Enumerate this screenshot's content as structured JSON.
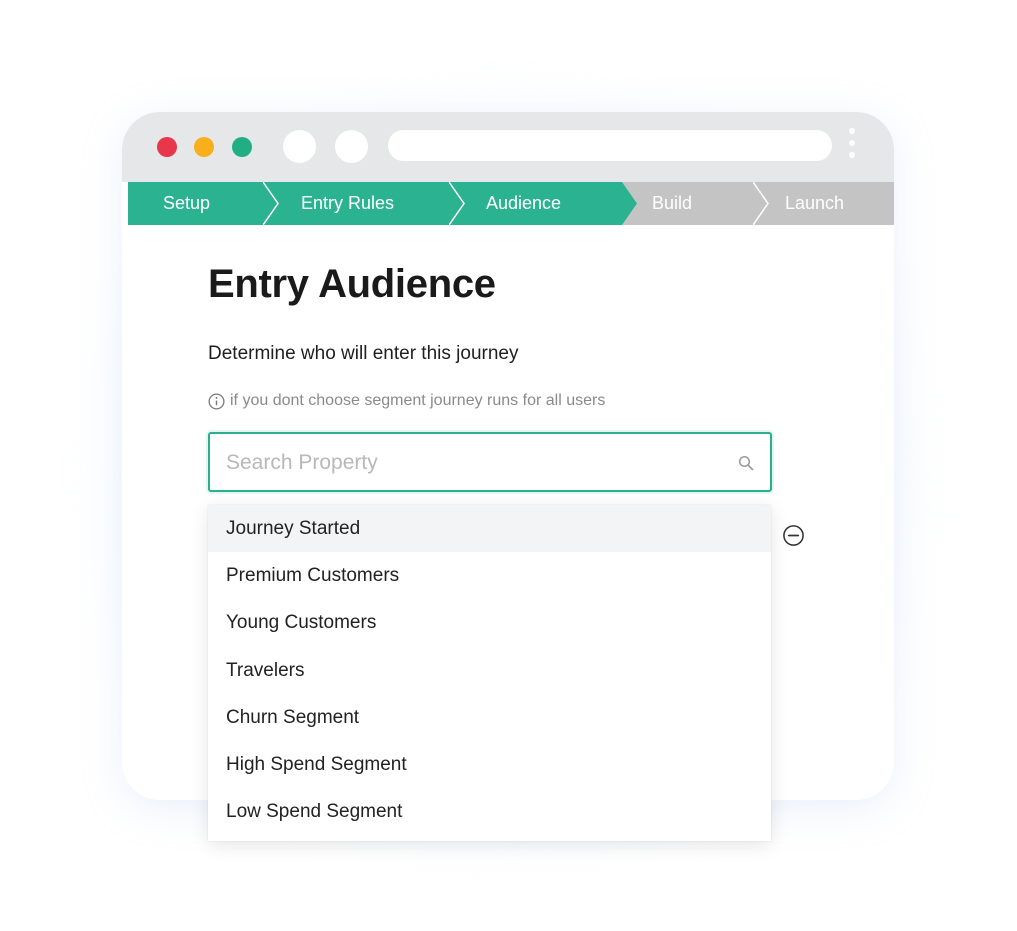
{
  "stepper": {
    "steps": [
      {
        "label": "Setup",
        "state": "done"
      },
      {
        "label": "Entry Rules",
        "state": "done"
      },
      {
        "label": "Audience",
        "state": "active"
      },
      {
        "label": "Build",
        "state": "pending"
      },
      {
        "label": "Launch",
        "state": "pending"
      }
    ]
  },
  "page": {
    "title": "Entry Audience",
    "subtitle": "Determine who will enter this journey",
    "hint": "if you dont choose segment journey runs for all users"
  },
  "search": {
    "placeholder": "Search Property",
    "value": ""
  },
  "dropdown": {
    "options": [
      "Journey Started",
      "Premium Customers",
      "Young Customers",
      "Travelers",
      "Churn Segment",
      "High Spend Segment",
      "Low Spend Segment"
    ],
    "highlighted_index": 0
  },
  "colors": {
    "accent": "#2bb08f",
    "step_done": "#2bb391",
    "step_pending": "#c4c4c4",
    "traffic_red": "#e8364a",
    "traffic_yellow": "#f7b01c",
    "traffic_green": "#22ae84"
  },
  "icons": {
    "info": "info-circle-icon",
    "search": "magnifier-icon",
    "remove": "minus-circle-icon",
    "menu": "kebab-icon"
  }
}
